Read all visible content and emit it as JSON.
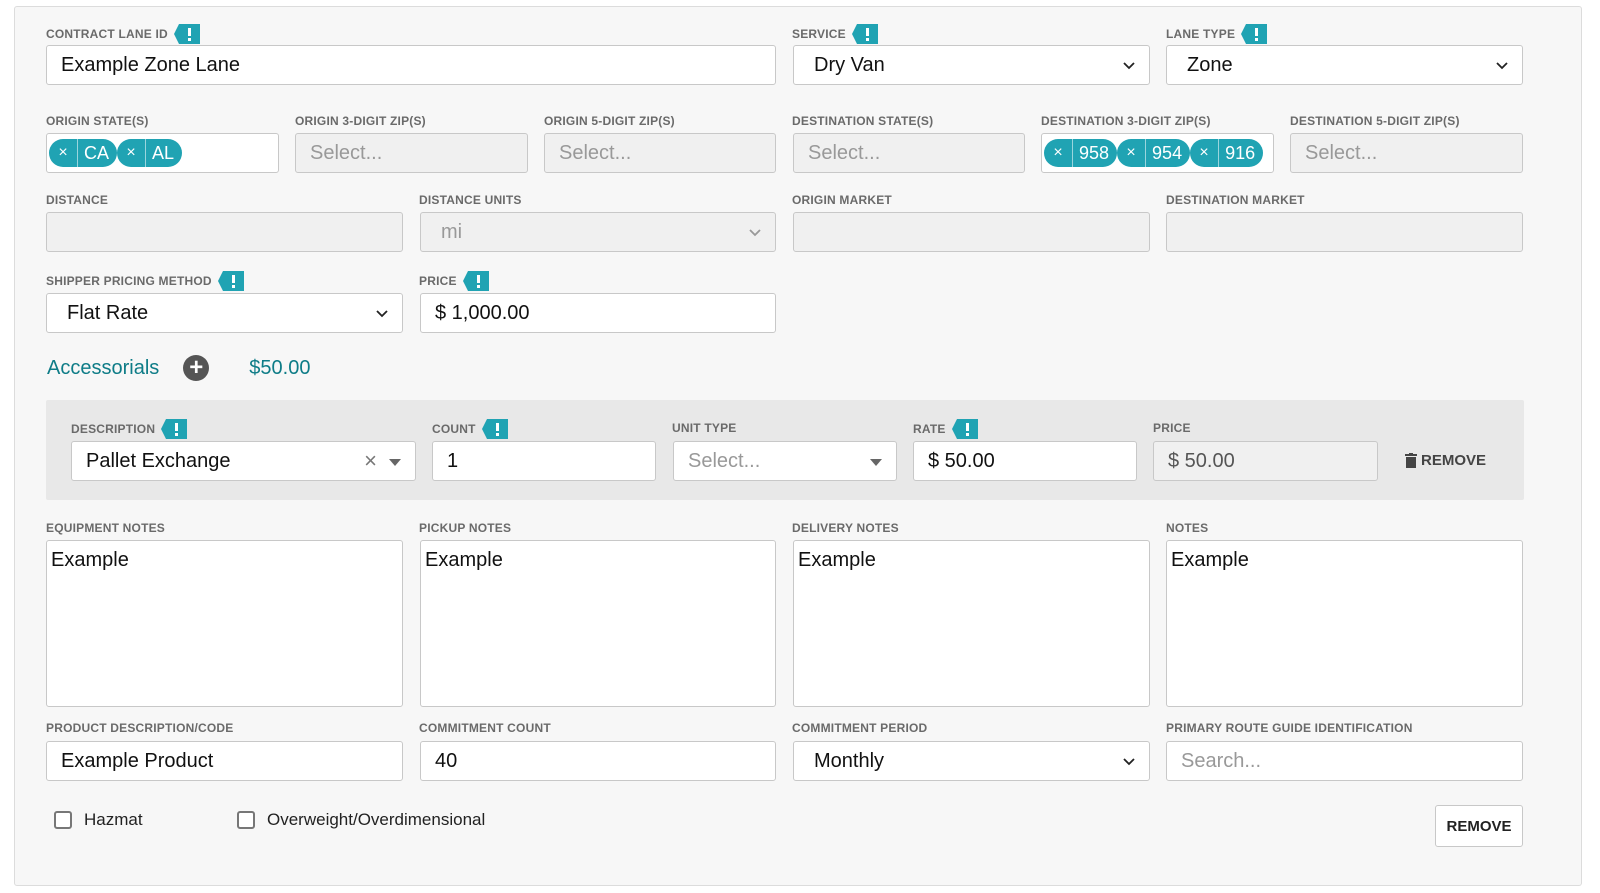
{
  "colors": {
    "accent": "#20a3b3",
    "link": "#0e7c87"
  },
  "row1": {
    "contract_lane_id": {
      "label": "CONTRACT LANE ID",
      "value": "Example Zone Lane"
    },
    "service": {
      "label": "SERVICE",
      "value": "Dry Van"
    },
    "lane_type": {
      "label": "LANE TYPE",
      "value": "Zone"
    }
  },
  "row2": {
    "origin_states": {
      "label": "ORIGIN STATE(S)",
      "chips": [
        "CA",
        "AL"
      ]
    },
    "origin_3zip": {
      "label": "ORIGIN 3-DIGIT ZIP(S)",
      "placeholder": "Select..."
    },
    "origin_5zip": {
      "label": "ORIGIN 5-DIGIT ZIP(S)",
      "placeholder": "Select..."
    },
    "dest_states": {
      "label": "DESTINATION STATE(S)",
      "placeholder": "Select..."
    },
    "dest_3zip": {
      "label": "DESTINATION 3-DIGIT ZIP(S)",
      "chips": [
        "958",
        "954",
        "916"
      ]
    },
    "dest_5zip": {
      "label": "DESTINATION 5-DIGIT ZIP(S)",
      "placeholder": "Select..."
    }
  },
  "row3": {
    "distance": {
      "label": "DISTANCE",
      "value": ""
    },
    "distance_units": {
      "label": "DISTANCE UNITS",
      "value": "mi"
    },
    "origin_market": {
      "label": "ORIGIN MARKET",
      "value": ""
    },
    "destination_market": {
      "label": "DESTINATION MARKET",
      "value": ""
    }
  },
  "row4": {
    "pricing_method": {
      "label": "SHIPPER PRICING METHOD",
      "value": "Flat Rate"
    },
    "price": {
      "label": "PRICE",
      "value": "$ 1,000.00"
    }
  },
  "accessorials": {
    "title": "Accessorials",
    "total": "$50.00",
    "item": {
      "description": {
        "label": "DESCRIPTION",
        "value": "Pallet Exchange"
      },
      "count": {
        "label": "COUNT",
        "value": "1"
      },
      "unit_type": {
        "label": "UNIT TYPE",
        "placeholder": "Select..."
      },
      "rate": {
        "label": "RATE",
        "value": "$ 50.00"
      },
      "price": {
        "label": "PRICE",
        "value": "$ 50.00"
      },
      "remove_label": "REMOVE"
    }
  },
  "notes": {
    "equipment": {
      "label": "EQUIPMENT NOTES",
      "value": "Example"
    },
    "pickup": {
      "label": "PICKUP NOTES",
      "value": "Example"
    },
    "delivery": {
      "label": "DELIVERY NOTES",
      "value": "Example"
    },
    "notes": {
      "label": "NOTES",
      "value": "Example"
    }
  },
  "row6": {
    "product": {
      "label": "PRODUCT DESCRIPTION/CODE",
      "value": "Example Product"
    },
    "commitment_count": {
      "label": "COMMITMENT COUNT",
      "value": "40"
    },
    "commitment_period": {
      "label": "COMMITMENT PERIOD",
      "value": "Monthly"
    },
    "route_guide": {
      "label": "PRIMARY ROUTE GUIDE IDENTIFICATION",
      "placeholder": "Search..."
    }
  },
  "footer": {
    "hazmat_label": "Hazmat",
    "overweight_label": "Overweight/Overdimensional",
    "remove_label": "REMOVE"
  },
  "icons": {
    "required": "required-flag-icon",
    "chevron": "chevron-down-icon",
    "plus": "add-circle-icon",
    "trash": "trash-icon",
    "clear": "clear-icon"
  }
}
